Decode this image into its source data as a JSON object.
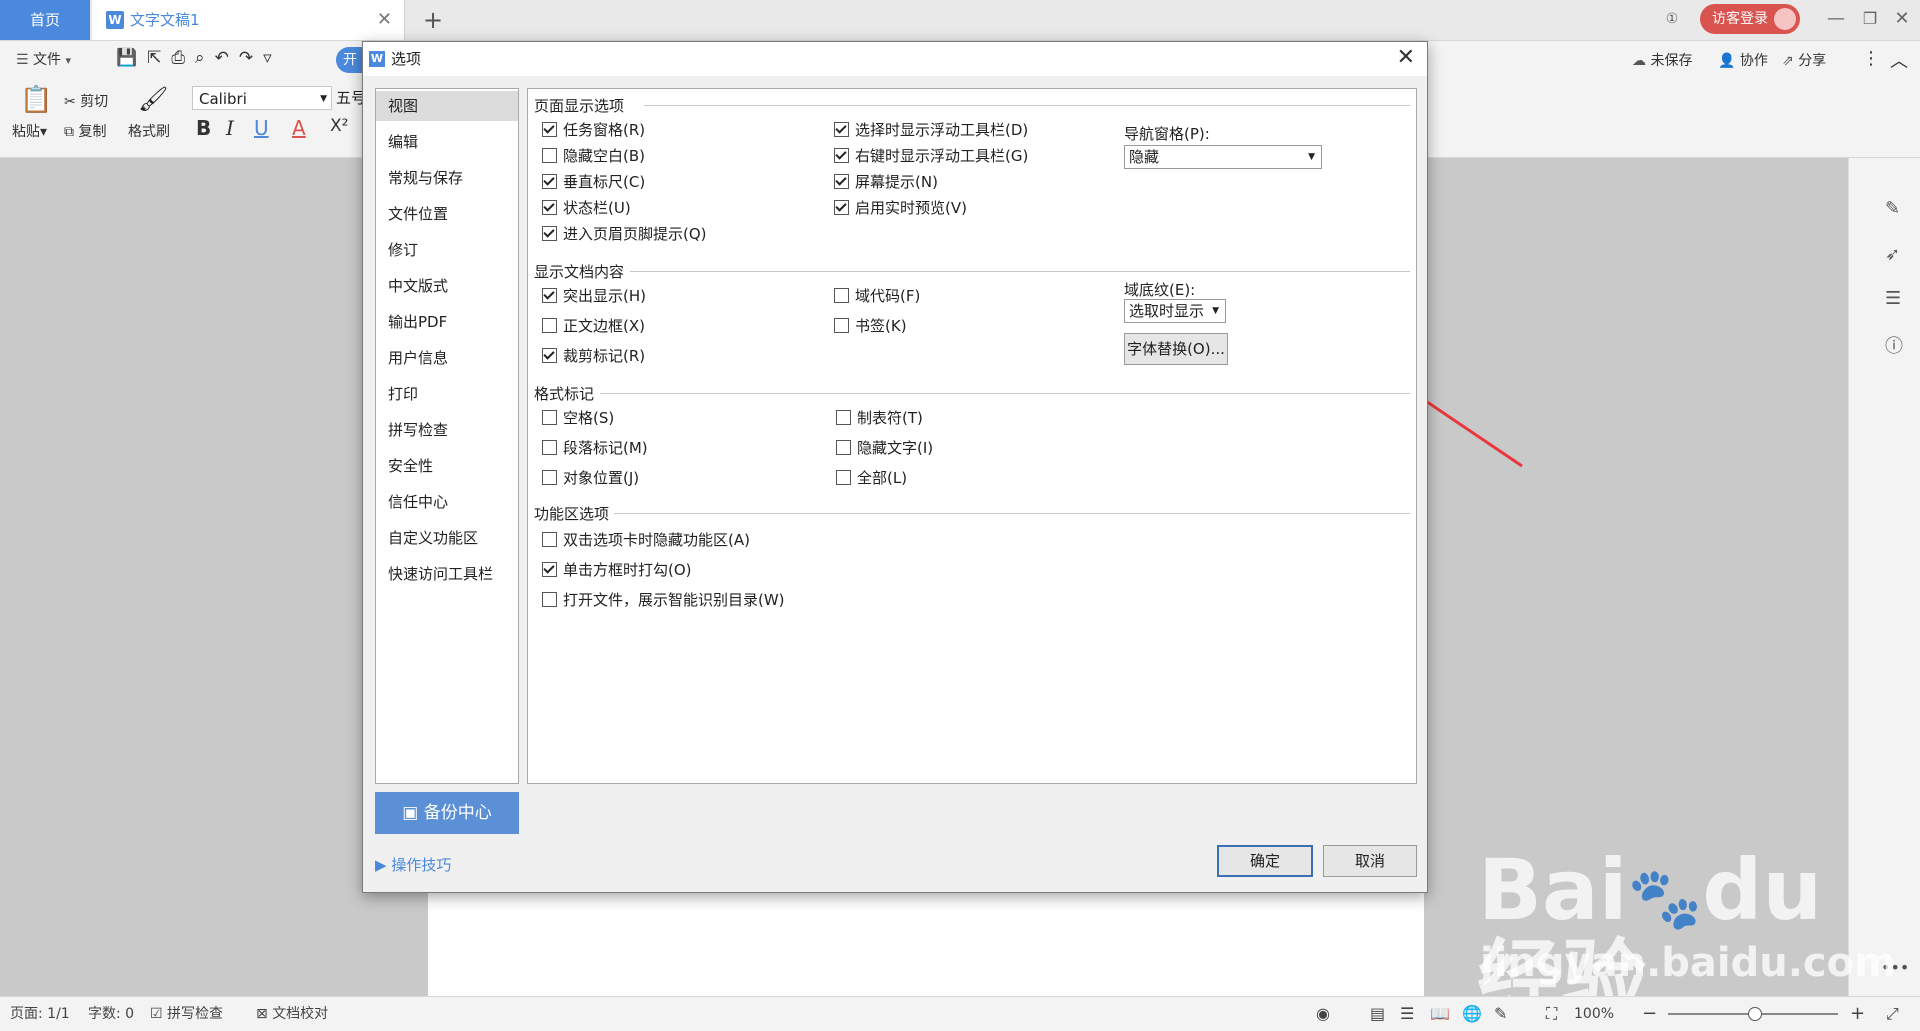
{
  "tabs": {
    "home": "首页",
    "doc": "文字文稿1"
  },
  "login": "访客登录",
  "menubar": {
    "file": "文件",
    "right": [
      "未保存",
      "协作",
      "分享"
    ]
  },
  "ribbon": {
    "paste": "粘贴",
    "cut": "剪切",
    "copy": "复制",
    "format_painter": "格式刷",
    "font": "Calibri",
    "size": "五号",
    "bold": "B",
    "italic": "I",
    "underline": "U",
    "fontcolor": "A",
    "superscript": "X²",
    "open_btn": "开"
  },
  "dialog": {
    "title": "选项",
    "nav": [
      "视图",
      "编辑",
      "常规与保存",
      "文件位置",
      "修订",
      "中文版式",
      "输出PDF",
      "用户信息",
      "打印",
      "拼写检查",
      "安全性",
      "信任中心",
      "自定义功能区",
      "快速访问工具栏"
    ],
    "selected_nav": "视图",
    "sections": {
      "page_display": "页面显示选项",
      "doc_content": "显示文档内容",
      "format_marks": "格式标记",
      "ribbon_opts": "功能区选项"
    },
    "page_display": [
      {
        "label": "任务窗格(R)",
        "checked": true
      },
      {
        "label": "隐藏空白(B)",
        "checked": false
      },
      {
        "label": "垂直标尺(C)",
        "checked": true
      },
      {
        "label": "状态栏(U)",
        "checked": true
      },
      {
        "label": "进入页眉页脚提示(Q)",
        "checked": true
      },
      {
        "label": "选择时显示浮动工具栏(D)",
        "checked": true
      },
      {
        "label": "右键时显示浮动工具栏(G)",
        "checked": true
      },
      {
        "label": "屏幕提示(N)",
        "checked": true
      },
      {
        "label": "启用实时预览(V)",
        "checked": true
      }
    ],
    "nav_pane_label": "导航窗格(P):",
    "nav_pane_value": "隐藏",
    "doc_content": [
      {
        "label": "突出显示(H)",
        "checked": true
      },
      {
        "label": "正文边框(X)",
        "checked": false
      },
      {
        "label": "裁剪标记(R)",
        "checked": true
      },
      {
        "label": "域代码(F)",
        "checked": false
      },
      {
        "label": "书签(K)",
        "checked": false
      }
    ],
    "field_shading_label": "域底纹(E):",
    "field_shading_value": "选取时显示",
    "font_subst": "字体替换(O)...",
    "format_marks": [
      {
        "label": "空格(S)",
        "checked": false
      },
      {
        "label": "段落标记(M)",
        "checked": false
      },
      {
        "label": "对象位置(J)",
        "checked": false
      },
      {
        "label": "制表符(T)",
        "checked": false
      },
      {
        "label": "隐藏文字(I)",
        "checked": false
      },
      {
        "label": "全部(L)",
        "checked": false
      }
    ],
    "ribbon_opts": [
      {
        "label": "双击选项卡时隐藏功能区(A)",
        "checked": false
      },
      {
        "label": "单击方框时打勾(O)",
        "checked": true
      },
      {
        "label": "打开文件，展示智能识别目录(W)",
        "checked": false
      }
    ],
    "backup": "备份中心",
    "tips": "操作技巧",
    "ok": "确定",
    "cancel": "取消"
  },
  "status": {
    "page": "页面: 1/1",
    "words": "字数: 0",
    "spell": "拼写检查",
    "proof": "文档校对",
    "zoom": "100%"
  },
  "watermark": {
    "brand": "Bai",
    "brand2": "du",
    "cn": "经验",
    "url": "jingyan.baidu.com"
  },
  "colors": {
    "accent": "#4a89dc",
    "arrow": "#e8383d",
    "login": "#d9534f"
  }
}
